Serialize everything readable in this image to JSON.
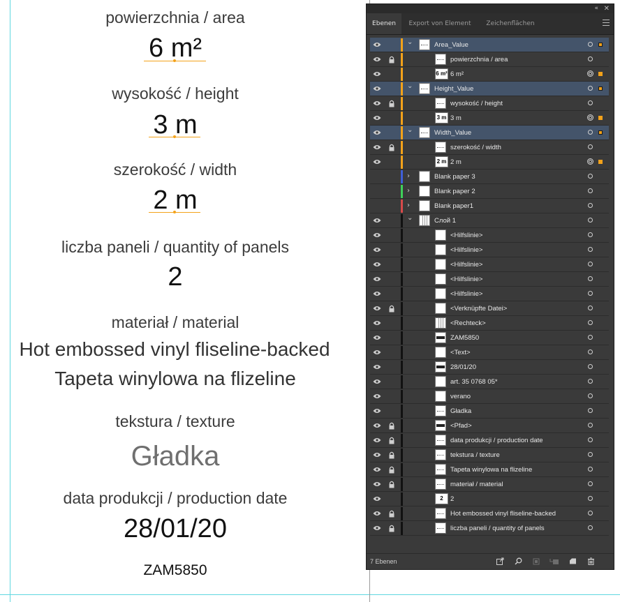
{
  "artboard": {
    "area_label": "powierzchnia / area",
    "area_value": "6 m²",
    "height_label": "wysokość / height",
    "height_value": "3 m",
    "width_label": "szerokość / width",
    "width_value": "2 m",
    "panels_label": "liczba paneli / quantity of panels",
    "panels_value": "2",
    "material_label": "materiał / material",
    "material_en": "Hot embossed vinyl fliseline-backed",
    "material_pl": "Tapeta winylowa na flizeline",
    "texture_label": "tekstura / texture",
    "texture_value": "Gładka",
    "date_label": "data produkcji / production date",
    "date_value": "28/01/20",
    "code": "ZAM5850"
  },
  "panel": {
    "tabs": [
      "Ebenen",
      "Export von Element",
      "Zeichenflächen"
    ],
    "active_tab": "Ebenen",
    "footer_count": "7 Ebenen",
    "accent_color": "#f3a21a",
    "layers": [
      {
        "name": "Area_Value",
        "level": 0,
        "selected": true,
        "eye": true,
        "lock": false,
        "color": "#f3a21a",
        "chevron": "down",
        "thumb": "lines",
        "target": "single",
        "selsq": "hollow"
      },
      {
        "name": "powierzchnia / area",
        "level": 1,
        "selected": false,
        "eye": true,
        "lock": true,
        "color": "#f3a21a",
        "thumb": "lines",
        "target": "single"
      },
      {
        "name": "6 m²",
        "level": 1,
        "selected": false,
        "eye": true,
        "lock": false,
        "color": "#f3a21a",
        "thumb": "text",
        "thumb_text": "6 m²",
        "target": "double",
        "selsq": "filled"
      },
      {
        "name": "Height_Value",
        "level": 0,
        "selected": true,
        "eye": true,
        "lock": false,
        "color": "#f3a21a",
        "chevron": "down",
        "thumb": "lines",
        "target": "single",
        "selsq": "hollow"
      },
      {
        "name": "wysokość / height",
        "level": 1,
        "selected": false,
        "eye": true,
        "lock": true,
        "color": "#f3a21a",
        "thumb": "lines",
        "target": "single"
      },
      {
        "name": "3 m",
        "level": 1,
        "selected": false,
        "eye": true,
        "lock": false,
        "color": "#f3a21a",
        "thumb": "text",
        "thumb_text": "3 m",
        "target": "double",
        "selsq": "filled"
      },
      {
        "name": "Width_Value",
        "level": 0,
        "selected": true,
        "eye": true,
        "lock": false,
        "color": "#f3a21a",
        "chevron": "down",
        "thumb": "lines",
        "target": "single",
        "selsq": "hollow"
      },
      {
        "name": "szerokość / width",
        "level": 1,
        "selected": false,
        "eye": true,
        "lock": true,
        "color": "#f3a21a",
        "thumb": "lines",
        "target": "single"
      },
      {
        "name": "2 m",
        "level": 1,
        "selected": false,
        "eye": true,
        "lock": false,
        "color": "#f3a21a",
        "thumb": "text",
        "thumb_text": "2 m",
        "target": "double",
        "selsq": "filled"
      },
      {
        "name": "Blank paper 3",
        "level": 0,
        "selected": false,
        "eye": false,
        "lock": false,
        "color": "#3f5fd8",
        "chevron": "right",
        "thumb": "blank",
        "target": "single"
      },
      {
        "name": "Blank paper 2",
        "level": 0,
        "selected": false,
        "eye": false,
        "lock": false,
        "color": "#3fd05a",
        "chevron": "right",
        "thumb": "blank",
        "target": "single"
      },
      {
        "name": "Blank paper1",
        "level": 0,
        "selected": false,
        "eye": false,
        "lock": false,
        "color": "#d84a4a",
        "chevron": "right",
        "thumb": "blank",
        "target": "single"
      },
      {
        "name": "Слой 1",
        "level": 0,
        "selected": false,
        "eye": true,
        "lock": false,
        "color": "#111111",
        "chevron": "down",
        "thumb": "grid",
        "target": "single"
      },
      {
        "name": "<Hilfslinie>",
        "level": 1,
        "selected": false,
        "eye": true,
        "lock": false,
        "color": "#111111",
        "thumb": "blank",
        "target": "single"
      },
      {
        "name": "<Hilfslinie>",
        "level": 1,
        "selected": false,
        "eye": true,
        "lock": false,
        "color": "#111111",
        "thumb": "blank",
        "target": "single"
      },
      {
        "name": "<Hilfslinie>",
        "level": 1,
        "selected": false,
        "eye": true,
        "lock": false,
        "color": "#111111",
        "thumb": "blank",
        "target": "single"
      },
      {
        "name": "<Hilfslinie>",
        "level": 1,
        "selected": false,
        "eye": true,
        "lock": false,
        "color": "#111111",
        "thumb": "blank",
        "target": "single"
      },
      {
        "name": "<Hilfslinie>",
        "level": 1,
        "selected": false,
        "eye": true,
        "lock": false,
        "color": "#111111",
        "thumb": "blank",
        "target": "single"
      },
      {
        "name": "<Verknüpfte Datei>",
        "level": 1,
        "selected": false,
        "eye": true,
        "lock": true,
        "color": "#111111",
        "thumb": "blank",
        "target": "single"
      },
      {
        "name": "<Rechteck>",
        "level": 1,
        "selected": false,
        "eye": true,
        "lock": false,
        "color": "#111111",
        "thumb": "grid",
        "target": "single"
      },
      {
        "name": "ZAM5850",
        "level": 1,
        "selected": false,
        "eye": true,
        "lock": false,
        "color": "#111111",
        "thumb": "bar",
        "target": "single"
      },
      {
        "name": "<Text>",
        "level": 1,
        "selected": false,
        "eye": true,
        "lock": false,
        "color": "#111111",
        "thumb": "blank",
        "target": "single"
      },
      {
        "name": "28/01/20",
        "level": 1,
        "selected": false,
        "eye": true,
        "lock": false,
        "color": "#111111",
        "thumb": "bar",
        "target": "single"
      },
      {
        "name": "art. 35 0768 05*",
        "level": 1,
        "selected": false,
        "eye": true,
        "lock": false,
        "color": "#111111",
        "thumb": "blank",
        "target": "single"
      },
      {
        "name": "verano",
        "level": 1,
        "selected": false,
        "eye": true,
        "lock": false,
        "color": "#111111",
        "thumb": "blank",
        "target": "single"
      },
      {
        "name": "Gładka",
        "level": 1,
        "selected": false,
        "eye": true,
        "lock": false,
        "color": "#111111",
        "thumb": "lines",
        "target": "single"
      },
      {
        "name": "<Pfad>",
        "level": 1,
        "selected": false,
        "eye": true,
        "lock": true,
        "color": "#111111",
        "thumb": "bar",
        "target": "single"
      },
      {
        "name": "data produkcji / production date",
        "level": 1,
        "selected": false,
        "eye": true,
        "lock": true,
        "color": "#111111",
        "thumb": "lines",
        "target": "single"
      },
      {
        "name": "tekstura / texture",
        "level": 1,
        "selected": false,
        "eye": true,
        "lock": true,
        "color": "#111111",
        "thumb": "lines",
        "target": "single"
      },
      {
        "name": "Tapeta winylowa na flizeline",
        "level": 1,
        "selected": false,
        "eye": true,
        "lock": true,
        "color": "#111111",
        "thumb": "lines",
        "target": "single"
      },
      {
        "name": "materiał / material",
        "level": 1,
        "selected": false,
        "eye": true,
        "lock": true,
        "color": "#111111",
        "thumb": "lines",
        "target": "single"
      },
      {
        "name": "2",
        "level": 1,
        "selected": false,
        "eye": true,
        "lock": false,
        "color": "#111111",
        "thumb": "text",
        "thumb_text": "2",
        "target": "single"
      },
      {
        "name": "Hot embossed vinyl fliseline-backed",
        "level": 1,
        "selected": false,
        "eye": true,
        "lock": true,
        "color": "#111111",
        "thumb": "lines",
        "target": "single"
      },
      {
        "name": "liczba paneli / quantity of panels",
        "level": 1,
        "selected": false,
        "eye": true,
        "lock": true,
        "color": "#111111",
        "thumb": "lines",
        "target": "single"
      }
    ]
  }
}
